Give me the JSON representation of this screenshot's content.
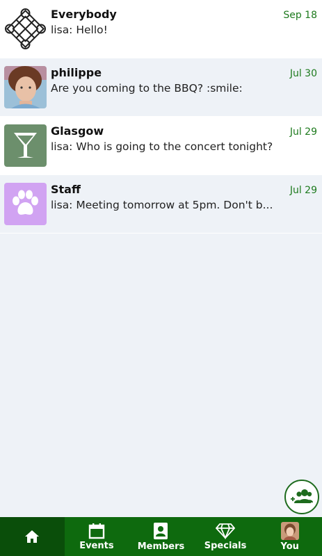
{
  "conversations": [
    {
      "name": "Everybody",
      "date": "Sep 18",
      "preview": "lisa: Hello!",
      "icon": "celtic-knot-icon"
    },
    {
      "name": "philippe",
      "date": "Jul 30",
      "preview": "Are you coming to the BBQ? :smile:",
      "icon": "user-photo"
    },
    {
      "name": "Glasgow",
      "date": "Jul 29",
      "preview": "lisa: Who is going to the concert tonight?",
      "icon": "cocktail-icon",
      "color": "#6c8f6c"
    },
    {
      "name": "Staff",
      "date": "Jul 29",
      "preview": "lisa: Meeting tomorrow at 5pm. Don't b...",
      "icon": "paw-icon",
      "color": "#d1a3f2"
    }
  ],
  "nav": {
    "home": "home-icon",
    "events": "Events",
    "members": "Members",
    "specials": "Specials",
    "you": "You"
  },
  "colors": {
    "accent": "#0e6a0e",
    "date": "#1d7a1d",
    "background": "#eef2f7"
  }
}
